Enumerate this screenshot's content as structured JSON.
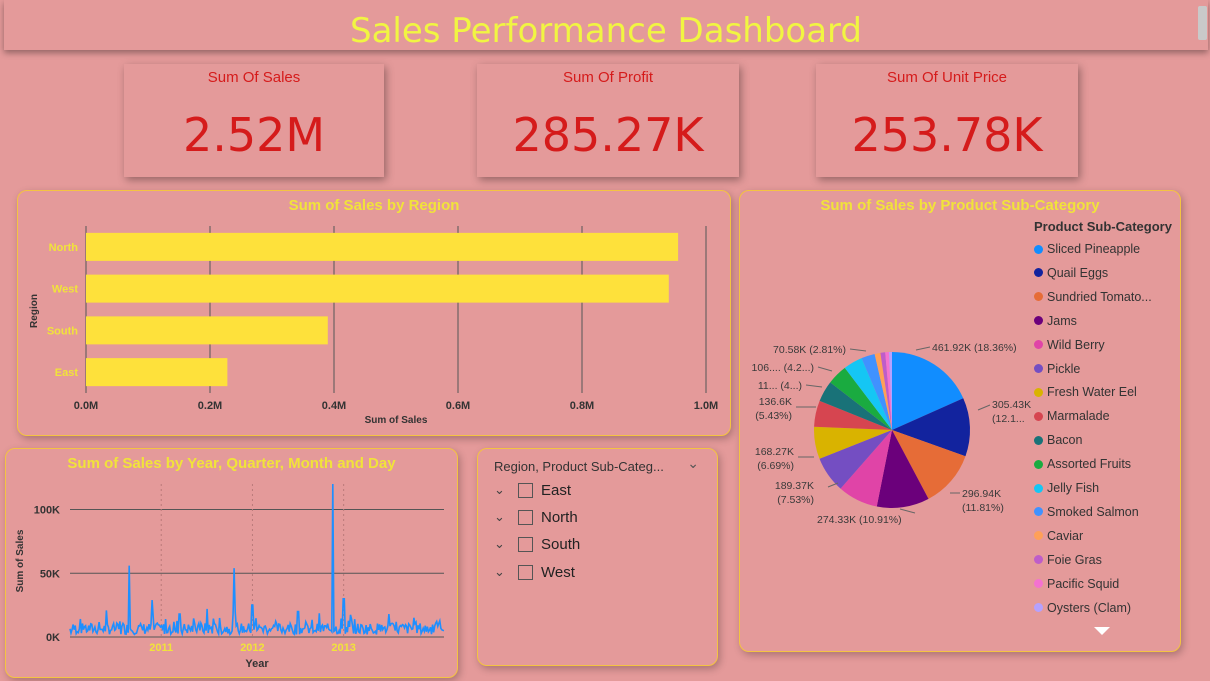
{
  "title": "Sales Performance Dashboard",
  "kpis": [
    {
      "label": "Sum Of Sales",
      "value": "2.52M"
    },
    {
      "label": "Sum Of Profit",
      "value": "285.27K"
    },
    {
      "label": "Sum Of Unit Price",
      "value": "253.78K"
    }
  ],
  "colors": {
    "background": "#e49a9a",
    "title": "#f1f542",
    "kpi": "#d51b1b",
    "bar": "#fee13b",
    "line": "#1e8fff",
    "panel_border": "#f4c342"
  },
  "region_chart": {
    "title": "Sum of Sales by Region",
    "chart_data": {
      "type": "bar",
      "orientation": "horizontal",
      "categories": [
        "North",
        "West",
        "South",
        "East"
      ],
      "values": [
        955000,
        940000,
        390000,
        228000
      ],
      "xlabel": "Sum of Sales",
      "ylabel": "Region",
      "xlim": [
        0,
        1000000
      ],
      "xticks": [
        "0.0M",
        "0.2M",
        "0.4M",
        "0.6M",
        "0.8M",
        "1.0M"
      ]
    }
  },
  "subcat_chart": {
    "title": "Sum of Sales by Product Sub-Category",
    "legend_title": "Product Sub-Category",
    "chart_data": {
      "type": "pie",
      "legend_position": "right",
      "slices": [
        {
          "name": "Sliced Pineapple",
          "value": 461.92,
          "color": "#118dff"
        },
        {
          "name": "Quail Eggs",
          "value": 305.43,
          "color": "#12239e"
        },
        {
          "name": "Sundried Tomato...",
          "value": 296.94,
          "color": "#e66c37"
        },
        {
          "name": "Jams",
          "value": 274.33,
          "color": "#6b007b"
        },
        {
          "name": "Wild Berry",
          "value": 210.0,
          "color": "#e044a7"
        },
        {
          "name": "Pickle",
          "value": 189.37,
          "color": "#744ec2"
        },
        {
          "name": "Fresh Water Eel",
          "value": 168.27,
          "color": "#d9b300"
        },
        {
          "name": "Marmalade",
          "value": 136.6,
          "color": "#d64550"
        },
        {
          "name": "Bacon",
          "value": 110.0,
          "color": "#197278"
        },
        {
          "name": "Assorted Fruits",
          "value": 106.0,
          "color": "#1aab40"
        },
        {
          "name": "Jelly Fish",
          "value": 100.0,
          "color": "#15c6f4"
        },
        {
          "name": "Smoked Salmon",
          "value": 70.58,
          "color": "#4092ff"
        },
        {
          "name": "Caviar",
          "value": 30.0,
          "color": "#ffa058"
        },
        {
          "name": "Foie Gras",
          "value": 25.0,
          "color": "#be5dc9"
        },
        {
          "name": "Pacific Squid",
          "value": 20.0,
          "color": "#f472d0"
        },
        {
          "name": "Oysters (Clam)",
          "value": 15.0,
          "color": "#b5a1ff"
        }
      ],
      "labels": [
        "461.92K (18.36%)",
        "305.43K",
        "(12.1...",
        "296.94K",
        "(11.81%)",
        "274.33K (10.91%)",
        "189.37K",
        "(7.53%)",
        "168.27K",
        "(6.69%)",
        "136.6K",
        "(5.43%)",
        "11... (4...)",
        "106.... (4.2...)",
        "70.58K (2.81%)"
      ]
    }
  },
  "time_chart": {
    "title": "Sum of Sales by Year, Quarter, Month and Day",
    "chart_data": {
      "type": "line",
      "xlabel": "Year",
      "ylabel": "Sum of Sales",
      "ylim": [
        0,
        120000
      ],
      "yticks": [
        "0K",
        "50K",
        "100K"
      ],
      "xticks": [
        "2011",
        "2012",
        "2013"
      ],
      "x_range": [
        2010.0,
        2014.1
      ],
      "spikes": [
        {
          "x": 2010.65,
          "y": 56000
        },
        {
          "x": 2010.9,
          "y": 29000
        },
        {
          "x": 2011.2,
          "y": 18000
        },
        {
          "x": 2011.5,
          "y": 22000
        },
        {
          "x": 2011.8,
          "y": 54000
        },
        {
          "x": 2012.0,
          "y": 25000
        },
        {
          "x": 2012.5,
          "y": 20000
        },
        {
          "x": 2012.88,
          "y": 120000
        },
        {
          "x": 2013.0,
          "y": 30000
        },
        {
          "x": 2013.5,
          "y": 18000
        }
      ]
    }
  },
  "slicer": {
    "header": "Region, Product Sub-Categ...",
    "items": [
      "East",
      "North",
      "South",
      "West"
    ]
  }
}
